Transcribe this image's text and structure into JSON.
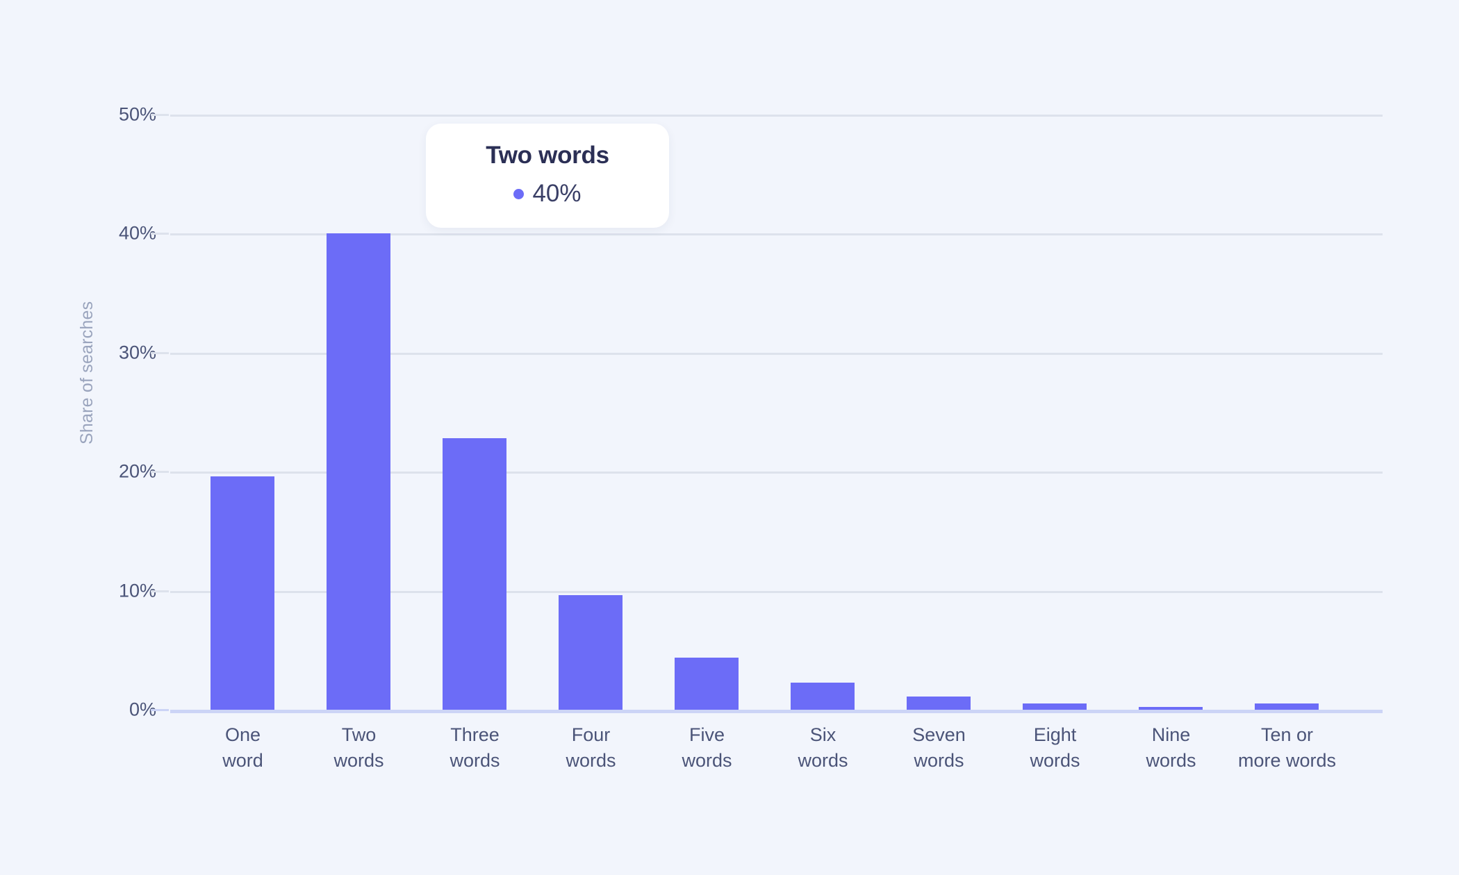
{
  "colors": {
    "background": "#f2f5fc",
    "bar": "#6c6cf7",
    "gridline": "#dde2ec",
    "baseline": "#ccd4f6",
    "tick_label": "#4b5478",
    "axis_title": "#9aa4bd",
    "tooltip_background": "#ffffff",
    "tooltip_title": "#2b2f55",
    "tooltip_value": "#3a3f66"
  },
  "tooltip": {
    "title": "Two words",
    "value": "40%",
    "marker": "bullet-dot"
  },
  "chart_data": {
    "type": "bar",
    "title": "",
    "subtitle": "",
    "xlabel": "",
    "ylabel": "Share of searches",
    "ylim": [
      0,
      50
    ],
    "yticks": [
      0,
      10,
      20,
      30,
      40,
      50
    ],
    "ytick_labels": [
      "0%",
      "10%",
      "20%",
      "30%",
      "40%",
      "50%"
    ],
    "grid": true,
    "legend": false,
    "legend_position": "none",
    "categories": [
      "One\nword",
      "Two\nwords",
      "Three\nwords",
      "Four\nwords",
      "Five\nwords",
      "Six\nwords",
      "Seven\nwords",
      "Eight\nwords",
      "Nine\nwords",
      "Ten or\nmore words"
    ],
    "values": [
      19.6,
      40.0,
      22.8,
      9.6,
      4.4,
      2.3,
      1.1,
      0.5,
      0.25,
      0.5
    ],
    "value_labels": [
      "",
      "40%",
      "",
      "",
      "",
      "",
      "",
      "",
      "",
      ""
    ],
    "annotations": [
      {
        "category": "Two words",
        "text": "40%",
        "kind": "tooltip"
      }
    ]
  }
}
